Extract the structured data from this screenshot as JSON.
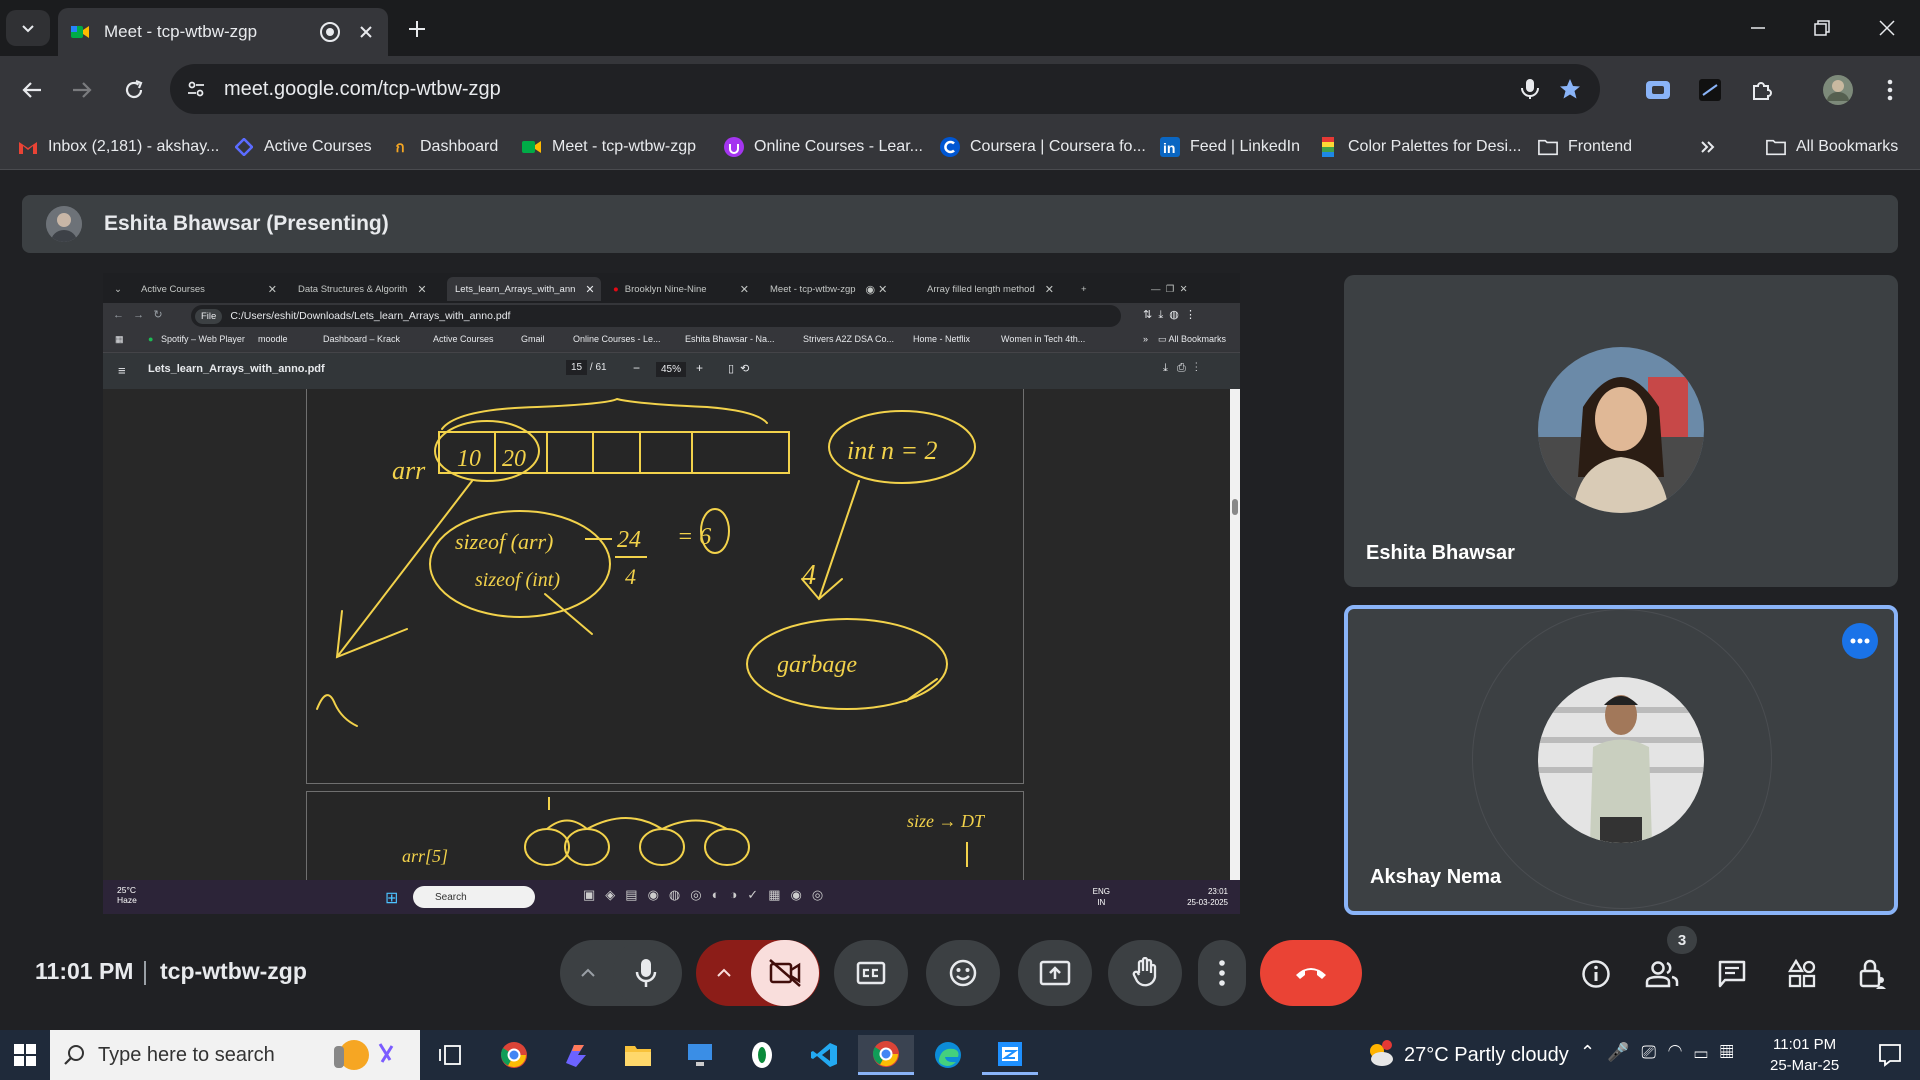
{
  "browser": {
    "active_tab_title": "Meet - tcp-wtbw-zgp",
    "url": "meet.google.com/tcp-wtbw-zgp",
    "bookmarks": [
      {
        "label": "Inbox (2,181) - akshay...",
        "icon": "gmail-icon"
      },
      {
        "label": "Active Courses",
        "icon": "courses-icon"
      },
      {
        "label": "Dashboard",
        "icon": "dashboard-icon"
      },
      {
        "label": "Meet - tcp-wtbw-zgp",
        "icon": "meet-icon"
      },
      {
        "label": "Online Courses - Lear...",
        "icon": "udemy-icon"
      },
      {
        "label": "Coursera | Coursera fo...",
        "icon": "coursera-icon"
      },
      {
        "label": "Feed | LinkedIn",
        "icon": "linkedin-icon"
      },
      {
        "label": "Color Palettes for Desi...",
        "icon": "palette-icon"
      },
      {
        "label": "Frontend",
        "icon": "folder-icon"
      }
    ],
    "all_bookmarks_label": "All Bookmarks"
  },
  "meet": {
    "presenter_label": "Eshita Bhawsar (Presenting)",
    "time": "11:01 PM",
    "meeting_code": "tcp-wtbw-zgp",
    "participant_count": "3",
    "participants": [
      {
        "name": "Eshita Bhawsar"
      },
      {
        "name": "Akshay Nema"
      }
    ],
    "colors": {
      "end_call": "#ea4335",
      "camera_off": "#f9dedc",
      "accent": "#8ab4f8"
    }
  },
  "shared_screen": {
    "tabs": [
      {
        "label": "Active Courses"
      },
      {
        "label": "Data Structures & Algorith"
      },
      {
        "label": "Lets_learn_Arrays_with_ann"
      },
      {
        "label": "Brooklyn Nine-Nine"
      },
      {
        "label": "Meet - tcp-wtbw-zgp"
      },
      {
        "label": "Array filled length method"
      }
    ],
    "file_chip": "File",
    "path": "C:/Users/eshit/Downloads/Lets_learn_Arrays_with_anno.pdf",
    "bookmarks": [
      "Spotify – Web Player",
      "moodle",
      "Dashboard – Krack",
      "Active Courses",
      "Gmail",
      "Online Courses - Le...",
      "Eshita Bhawsar - Na...",
      "Strivers A2Z DSA Co...",
      "Home - Netflix",
      "Women in Tech 4th..."
    ],
    "all_bookmarks": "All Bookmarks",
    "pdf_title": "Lets_learn_Arrays_with_anno.pdf",
    "page_current": "15",
    "page_total": "/ 61",
    "zoom": "45%",
    "annotations": {
      "arr_label": "arr",
      "cell_1": "10",
      "cell_2": "20",
      "int_n": "int n = 2",
      "sizeof_arr": "sizeof (arr)",
      "sizeof_int": "sizeof (int)",
      "frac_num": "24",
      "frac_den": "4",
      "equals_six": "= 6",
      "four": "4",
      "garbage": "garbage",
      "size_dt": "size → DT"
    },
    "taskbar": {
      "temp": "25°C",
      "weather": "Haze",
      "search": "Search",
      "lang_1": "ENG",
      "lang_2": "IN",
      "time": "23:01",
      "date": "25-03-2025"
    }
  },
  "windows_taskbar": {
    "search_placeholder": "Type here to search",
    "weather": "27°C  Partly cloudy",
    "time": "11:01 PM",
    "date": "25-Mar-25"
  }
}
